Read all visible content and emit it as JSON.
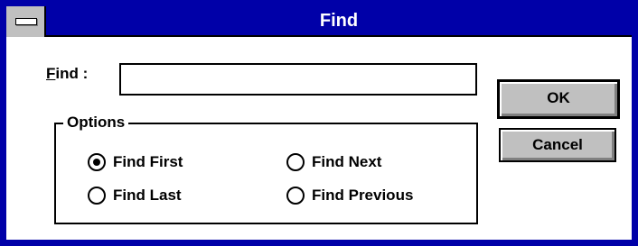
{
  "window": {
    "title": "Find"
  },
  "find": {
    "label_accel": "F",
    "label_rest": "ind :",
    "value": "",
    "placeholder": ""
  },
  "buttons": {
    "ok_label": "OK",
    "cancel_label": "Cancel"
  },
  "options": {
    "group_label": "Options",
    "items": [
      {
        "label": "Find First",
        "selected": true
      },
      {
        "label": "Find Next",
        "selected": false
      },
      {
        "label": "Find Last",
        "selected": false
      },
      {
        "label": "Find Previous",
        "selected": false
      }
    ]
  },
  "colors": {
    "titlebar": "#0000a8",
    "button_face": "#c0c0c0",
    "title_text": "#ffffff"
  }
}
